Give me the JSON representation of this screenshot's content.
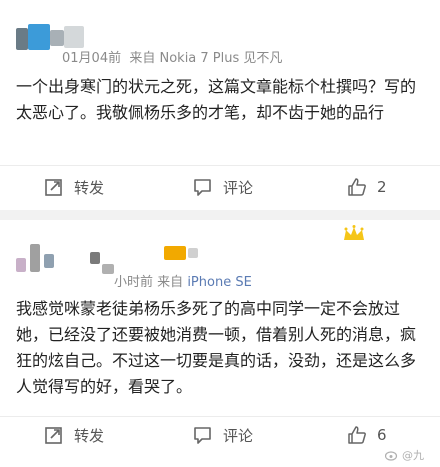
{
  "post1": {
    "meta_time": "01月04前",
    "meta_source": "来自 Nokia 7 Plus 见不凡",
    "body": "一个出身寒门的状元之死，这篇文章能标个杜撰吗？写的太恶心了。我敬佩杨乐多的才笔，却不齿于她的品行",
    "repost_label": "转发",
    "comment_label": "评论",
    "like_count": "2"
  },
  "post2": {
    "meta_time": "小时前",
    "meta_source_prefix": "来自",
    "meta_source_device": "iPhone SE",
    "body": "我感觉咪蒙老徒弟杨乐多死了的高中同学一定不会放过她，已经没了还要被她消费一顿，借着别人死的消息，疯狂的炫自己。不过这一切要是真的话，没劲，还是这么多人觉得写的好，看哭了。",
    "repost_label": "转发",
    "comment_label": "评论",
    "like_count": "6"
  },
  "watermark": "@九",
  "colors": {
    "background": "#f2f2f2",
    "card": "#ffffff",
    "text": "#222222",
    "meta": "#8a8a8a",
    "link": "#5b7bb3",
    "crown": "#f5c518"
  },
  "icons": [
    "repost-icon",
    "comment-icon",
    "like-icon",
    "crown-icon",
    "weibo-logo-icon"
  ]
}
